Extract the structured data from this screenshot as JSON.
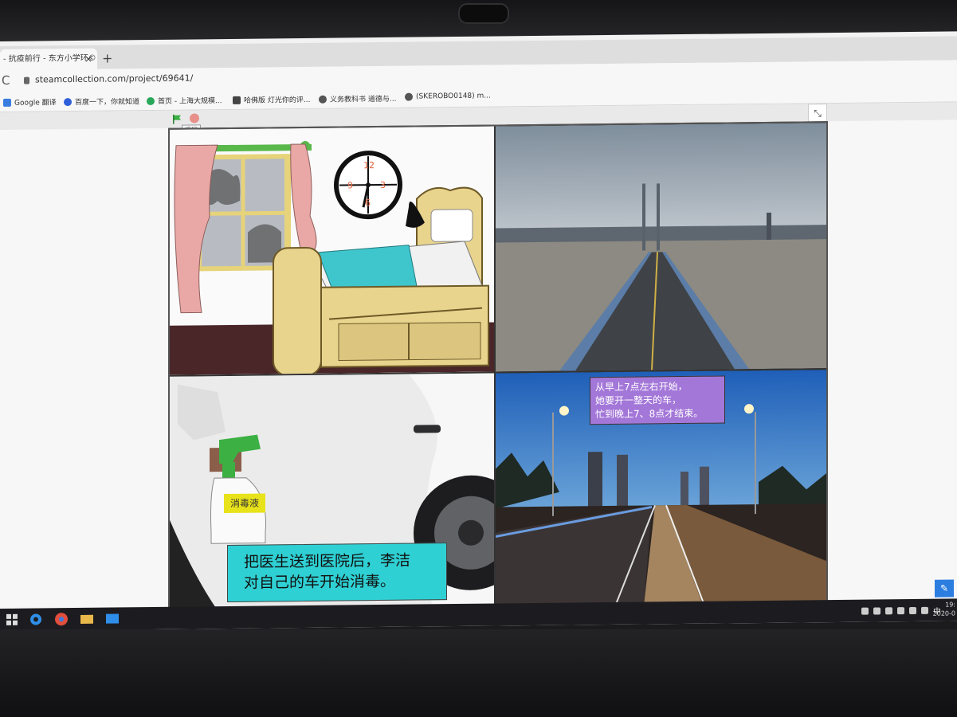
{
  "browser": {
    "tab_title": "- 抗疫前行 - 东方小学环©",
    "tab_close": "×",
    "new_tab": "+",
    "reload": "C",
    "url": "steamcollection.com/project/69641/",
    "bookmarks": [
      "Google 翻译",
      "百度一下，你就知道",
      "首页 - 上海大规模...",
      "哈佛版 灯光你的评...",
      "义务教科书 道德与...",
      "(SKEROBO0148) m..."
    ]
  },
  "player": {
    "tooltip": "运行",
    "fullscreen_icon": "⤡"
  },
  "scenes": {
    "clock_numbers": [
      "12",
      "3",
      "6",
      "9"
    ],
    "bottle_label": "消毒液",
    "caption_bottom_left": [
      "把医生送到医院后，李洁",
      "对自己的车开始消毒。"
    ],
    "caption_bottom_right": [
      "从早上7点左右开始，",
      "她要开一整天的车，",
      "忙到晚上7、8点才结束。"
    ]
  },
  "taskbar": {
    "tray_lang": "中",
    "time": "19:",
    "date": "2020-0"
  },
  "colors": {
    "caption_cyan": "#2fd0d3",
    "caption_purple": "#a377d8",
    "label_yellow": "#e8e21a"
  }
}
